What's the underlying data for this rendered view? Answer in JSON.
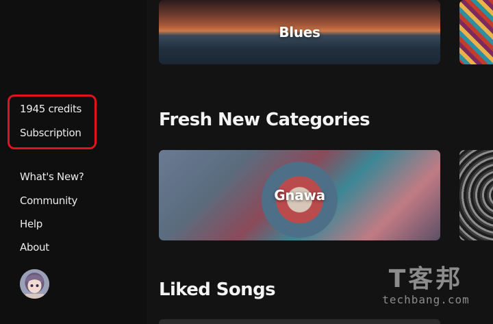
{
  "sidebar": {
    "account": {
      "credits": "1945 credits",
      "subscription": "Subscription"
    },
    "links": [
      {
        "label": "What's New?"
      },
      {
        "label": "Community"
      },
      {
        "label": "Help"
      },
      {
        "label": "About"
      }
    ],
    "highlight_color": "#e0141e"
  },
  "main": {
    "top_row": [
      {
        "label": "Blues"
      },
      {
        "label": ""
      }
    ],
    "sections": [
      {
        "title": "Fresh New Categories",
        "cards": [
          {
            "label": "Gnawa"
          },
          {
            "label": ""
          }
        ]
      },
      {
        "title": "Liked Songs",
        "cards": []
      }
    ]
  },
  "watermark": {
    "brand": "T客邦",
    "url": "techbang.com"
  }
}
